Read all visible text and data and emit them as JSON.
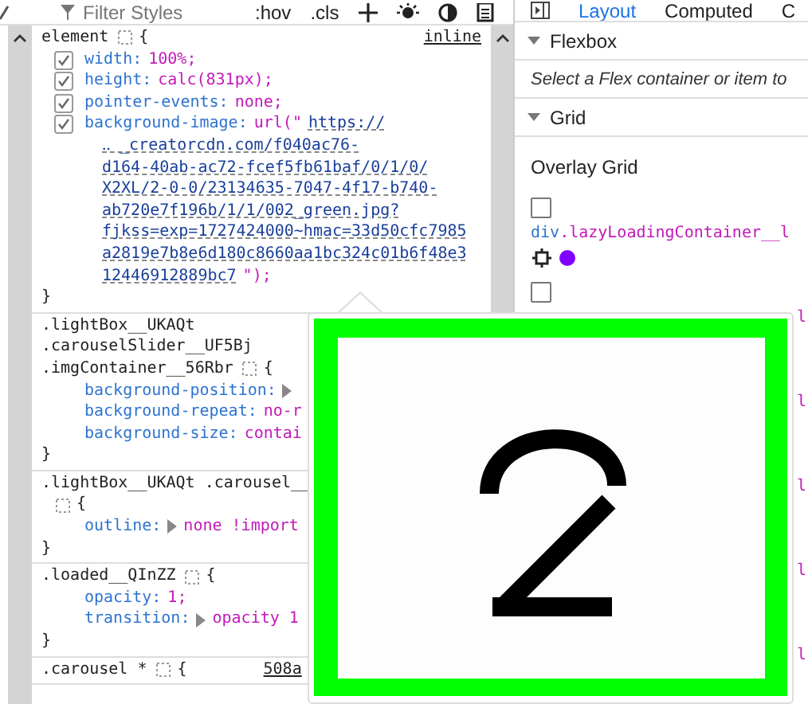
{
  "toolbar": {
    "filter_placeholder": "Filter Styles",
    "buttons": [
      ":hov",
      ".cls"
    ]
  },
  "rules": [
    {
      "selector_lines": [
        "element"
      ],
      "icon_wraps": false,
      "open_brace": "{",
      "close_brace": "}",
      "source": "inline",
      "source_cut": false,
      "declarations": [
        {
          "kind": "plain",
          "checked": true,
          "property": "width:",
          "value": "100%;"
        },
        {
          "kind": "plain",
          "checked": true,
          "property": "height:",
          "value": "calc(831px);"
        },
        {
          "kind": "plain",
          "checked": true,
          "property": "pointer-events:",
          "value": "none;"
        },
        {
          "kind": "url",
          "checked": true,
          "property": "background-image:",
          "prefix": "url(\"",
          "link_lines": [
            "https://",
            "‥  _creatorcdn.com/f040ac76-",
            "d164-40ab-ac72-fcef5fb61baf/0/1/0/",
            "X2XL/2-0-0/23134635-7047-4f17-b740-",
            "ab720e7f196b/1/1/002_green.jpg?",
            "fjkss=exp=1727424000~hmac=33d50cfc7985",
            "a2819e7b8e6d180c8660aa1bc324c01b6f48e3",
            "12446912889bc7"
          ],
          "suffix": "\");"
        }
      ]
    },
    {
      "selector_lines": [
        ".lightBox__UKAQt",
        ".carouselSlider__UF5Bj",
        ".imgContainer__56Rbr"
      ],
      "icon_wraps": false,
      "open_brace": "{",
      "close_brace": "}",
      "declarations": [
        {
          "kind": "expandable",
          "property": "background-position:"
        },
        {
          "kind": "plain",
          "property": "background-repeat:",
          "value": "no-r"
        },
        {
          "kind": "plain",
          "property": "background-size:",
          "value": "contai"
        }
      ]
    },
    {
      "selector_lines": [
        ".lightBox__UKAQt .carousel__"
      ],
      "icon_wraps": true,
      "open_brace": "{",
      "close_brace": "}",
      "declarations": [
        {
          "kind": "expandable",
          "property": "outline:",
          "value": "none !import"
        }
      ]
    },
    {
      "selector_lines": [
        ".loaded__QInZZ"
      ],
      "icon_wraps": false,
      "open_brace": "{",
      "close_brace": "}",
      "declarations": [
        {
          "kind": "plain",
          "property": "opacity:",
          "value": "1;"
        },
        {
          "kind": "expandable",
          "property": "transition:",
          "value": "opacity 1"
        }
      ]
    },
    {
      "selector_lines": [
        ".carousel *"
      ],
      "icon_wraps": false,
      "open_brace": "{",
      "source": "508a",
      "source_cut": true
    }
  ],
  "sidebar": {
    "tabs": [
      {
        "label": "Layout",
        "selected": true
      },
      {
        "label": "Computed",
        "selected": false
      },
      {
        "label": "C",
        "selected": false
      }
    ],
    "flexbox": {
      "title": "Flexbox",
      "expanded": true,
      "message": "Select a Flex container or item to"
    },
    "grid": {
      "title": "Grid",
      "expanded": true,
      "overlay_title": "Overlay Grid",
      "items": [
        {
          "kind": "full",
          "checked": false,
          "tag": "div",
          "class_name": ".lazyLoadingContainer__l",
          "color": "#8000ff"
        },
        {
          "kind": "partial",
          "checked": false,
          "label": "l"
        },
        {
          "kind": "label",
          "label": "l"
        },
        {
          "kind": "label",
          "label": "l"
        },
        {
          "kind": "label",
          "label": "l"
        },
        {
          "kind": "label",
          "label": "l"
        }
      ]
    }
  }
}
